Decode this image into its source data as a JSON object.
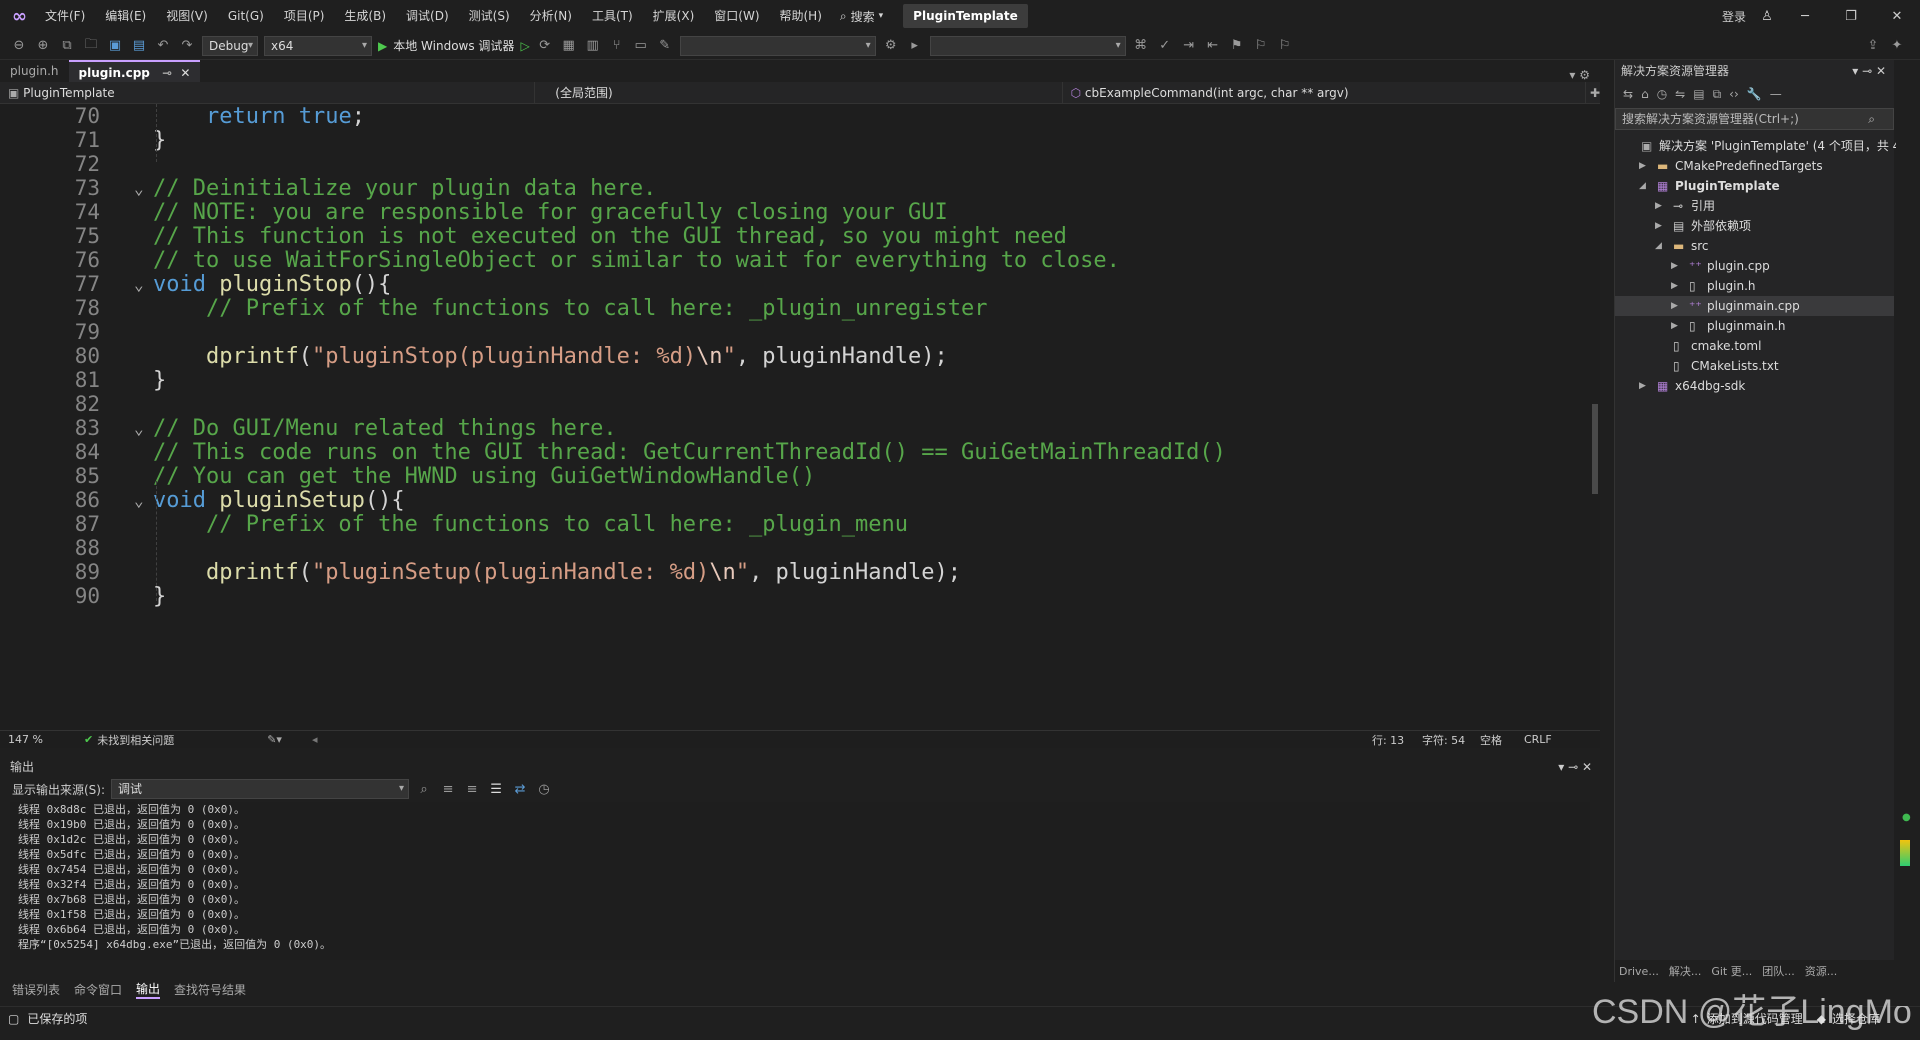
{
  "titlebar": {
    "menu": [
      "文件(F)",
      "编辑(E)",
      "视图(V)",
      "Git(G)",
      "项目(P)",
      "生成(B)",
      "调试(D)",
      "测试(S)",
      "分析(N)",
      "工具(T)",
      "扩展(X)",
      "窗口(W)",
      "帮助(H)"
    ],
    "search_label": "搜索",
    "solution_name": "PluginTemplate",
    "login_label": "登录"
  },
  "toolbar": {
    "config": "Debug",
    "platform": "x64",
    "run_label": "本地 Windows 调试器"
  },
  "tabs": [
    {
      "label": "plugin.h",
      "active": false
    },
    {
      "label": "plugin.cpp",
      "active": true
    }
  ],
  "navbar": {
    "project": "PluginTemplate",
    "scope": "(全局范围)",
    "member": "cbExampleCommand(int argc, char ** argv)"
  },
  "code_lines": [
    {
      "n": "70",
      "fold": "",
      "tokens": [
        {
          "t": "    ",
          "c": "pl"
        },
        {
          "t": "return",
          "c": "kw"
        },
        {
          "t": " ",
          "c": "pl"
        },
        {
          "t": "true",
          "c": "kw"
        },
        {
          "t": ";",
          "c": "pl"
        }
      ]
    },
    {
      "n": "71",
      "fold": "",
      "tokens": [
        {
          "t": "}",
          "c": "pl"
        }
      ]
    },
    {
      "n": "72",
      "fold": "",
      "tokens": []
    },
    {
      "n": "73",
      "fold": "v",
      "tokens": [
        {
          "t": "// Deinitialize your plugin data here.",
          "c": "cm"
        }
      ]
    },
    {
      "n": "74",
      "fold": "",
      "tokens": [
        {
          "t": "// NOTE: you are responsible for gracefully closing your GUI",
          "c": "cm"
        }
      ]
    },
    {
      "n": "75",
      "fold": "",
      "tokens": [
        {
          "t": "// This function is not executed on the GUI thread, so you might need",
          "c": "cm"
        }
      ]
    },
    {
      "n": "76",
      "fold": "",
      "tokens": [
        {
          "t": "// to use WaitForSingleObject or similar to wait for everything to close.",
          "c": "cm"
        }
      ]
    },
    {
      "n": "77",
      "fold": "v",
      "tokens": [
        {
          "t": "void",
          "c": "kw"
        },
        {
          "t": " ",
          "c": "pl"
        },
        {
          "t": "pluginStop",
          "c": "fn"
        },
        {
          "t": "(){",
          "c": "pl"
        }
      ]
    },
    {
      "n": "78",
      "fold": "",
      "tokens": [
        {
          "t": "    ",
          "c": "pl"
        },
        {
          "t": "// Prefix of the functions to call here: _plugin_unregister",
          "c": "cm"
        }
      ]
    },
    {
      "n": "79",
      "fold": "",
      "tokens": []
    },
    {
      "n": "80",
      "fold": "",
      "tokens": [
        {
          "t": "    ",
          "c": "pl"
        },
        {
          "t": "dprintf",
          "c": "fn"
        },
        {
          "t": "(",
          "c": "pl"
        },
        {
          "t": "\"pluginStop(pluginHandle: %d)",
          "c": "st"
        },
        {
          "t": "\\n",
          "c": "es"
        },
        {
          "t": "\"",
          "c": "st"
        },
        {
          "t": ", pluginHandle);",
          "c": "pl"
        }
      ]
    },
    {
      "n": "81",
      "fold": "",
      "tokens": [
        {
          "t": "}",
          "c": "pl"
        }
      ]
    },
    {
      "n": "82",
      "fold": "",
      "tokens": []
    },
    {
      "n": "83",
      "fold": "v",
      "tokens": [
        {
          "t": "// Do GUI/Menu related things here.",
          "c": "cm"
        }
      ]
    },
    {
      "n": "84",
      "fold": "",
      "tokens": [
        {
          "t": "// This code runs on the GUI thread: GetCurrentThreadId() == GuiGetMainThreadId()",
          "c": "cm"
        }
      ]
    },
    {
      "n": "85",
      "fold": "",
      "tokens": [
        {
          "t": "// You can get the HWND using GuiGetWindowHandle()",
          "c": "cm"
        }
      ]
    },
    {
      "n": "86",
      "fold": "v",
      "tokens": [
        {
          "t": "void",
          "c": "kw"
        },
        {
          "t": " ",
          "c": "pl"
        },
        {
          "t": "pluginSetup",
          "c": "fn"
        },
        {
          "t": "(){",
          "c": "pl"
        }
      ]
    },
    {
      "n": "87",
      "fold": "",
      "tokens": [
        {
          "t": "    ",
          "c": "pl"
        },
        {
          "t": "// Prefix of the functions to call here: _plugin_menu",
          "c": "cm"
        }
      ]
    },
    {
      "n": "88",
      "fold": "",
      "tokens": []
    },
    {
      "n": "89",
      "fold": "",
      "tokens": [
        {
          "t": "    ",
          "c": "pl"
        },
        {
          "t": "dprintf",
          "c": "fn"
        },
        {
          "t": "(",
          "c": "pl"
        },
        {
          "t": "\"pluginSetup(pluginHandle: %d)",
          "c": "st"
        },
        {
          "t": "\\n",
          "c": "es"
        },
        {
          "t": "\"",
          "c": "st"
        },
        {
          "t": ", pluginHandle);",
          "c": "pl"
        }
      ]
    },
    {
      "n": "90",
      "fold": "",
      "tokens": [
        {
          "t": "}",
          "c": "pl"
        }
      ]
    }
  ],
  "editor_status": {
    "zoom": "147 %",
    "issues": "未找到相关问题",
    "line": "行: 13",
    "char": "字符: 54",
    "spaces": "空格",
    "eol": "CRLF"
  },
  "output": {
    "title": "输出",
    "source_label": "显示输出来源(S):",
    "source_value": "调试",
    "lines": [
      "线程 0x8d8c 已退出，返回值为 0 (0x0)。",
      "线程 0x19b0 已退出，返回值为 0 (0x0)。",
      "线程 0x1d2c 已退出，返回值为 0 (0x0)。",
      "线程 0x5dfc 已退出，返回值为 0 (0x0)。",
      "线程 0x7454 已退出，返回值为 0 (0x0)。",
      "线程 0x32f4 已退出，返回值为 0 (0x0)。",
      "线程 0x7b68 已退出，返回值为 0 (0x0)。",
      "线程 0x1f58 已退出，返回值为 0 (0x0)。",
      "线程 0x6b64 已退出，返回值为 0 (0x0)。",
      "程序“[0x5254] x64dbg.exe”已退出，返回值为 0 (0x0)。"
    ]
  },
  "bottom_tabs": [
    "错误列表",
    "命令窗口",
    "输出",
    "查找符号结果"
  ],
  "statusbar": {
    "left": "已保存的项",
    "right": "添加到源代码管理",
    "right2": "选择仓库",
    "watermark": "CSDN @花子LingMo"
  },
  "solution": {
    "title": "解决方案资源管理器",
    "search_placeholder": "搜索解决方案资源管理器(Ctrl+;)",
    "nodes": [
      {
        "label": "解决方案 'PluginTemplate' (4 个项目，共 4",
        "indent": 0,
        "arrow": "",
        "icon": "solution-icon",
        "bold": false,
        "sel": false
      },
      {
        "label": "CMakePredefinedTargets",
        "indent": 1,
        "arrow": "▶",
        "icon": "folder-icon",
        "bold": false,
        "sel": false
      },
      {
        "label": "PluginTemplate",
        "indent": 1,
        "arrow": "◢",
        "icon": "project-icon",
        "bold": true,
        "sel": false
      },
      {
        "label": "引用",
        "indent": 2,
        "arrow": "▶",
        "icon": "references-icon",
        "bold": false,
        "sel": false
      },
      {
        "label": "外部依赖项",
        "indent": 2,
        "arrow": "▶",
        "icon": "dependencies-icon",
        "bold": false,
        "sel": false
      },
      {
        "label": "src",
        "indent": 2,
        "arrow": "◢",
        "icon": "folder-icon",
        "bold": false,
        "sel": false
      },
      {
        "label": "plugin.cpp",
        "indent": 3,
        "arrow": "▶",
        "icon": "cpp-file-icon",
        "bold": false,
        "sel": false
      },
      {
        "label": "plugin.h",
        "indent": 3,
        "arrow": "▶",
        "icon": "header-file-icon",
        "bold": false,
        "sel": false
      },
      {
        "label": "pluginmain.cpp",
        "indent": 3,
        "arrow": "▶",
        "icon": "cpp-file-icon",
        "bold": false,
        "sel": true
      },
      {
        "label": "pluginmain.h",
        "indent": 3,
        "arrow": "▶",
        "icon": "header-file-icon",
        "bold": false,
        "sel": false
      },
      {
        "label": "cmake.toml",
        "indent": 2,
        "arrow": "",
        "icon": "file-icon",
        "bold": false,
        "sel": false
      },
      {
        "label": "CMakeLists.txt",
        "indent": 2,
        "arrow": "",
        "icon": "file-icon",
        "bold": false,
        "sel": false
      },
      {
        "label": "x64dbg-sdk",
        "indent": 1,
        "arrow": "▶",
        "icon": "project-icon",
        "bold": false,
        "sel": false
      }
    ],
    "bottom_tabs": [
      "Drive...",
      "解决...",
      "Git 更...",
      "团队...",
      "资源..."
    ]
  }
}
